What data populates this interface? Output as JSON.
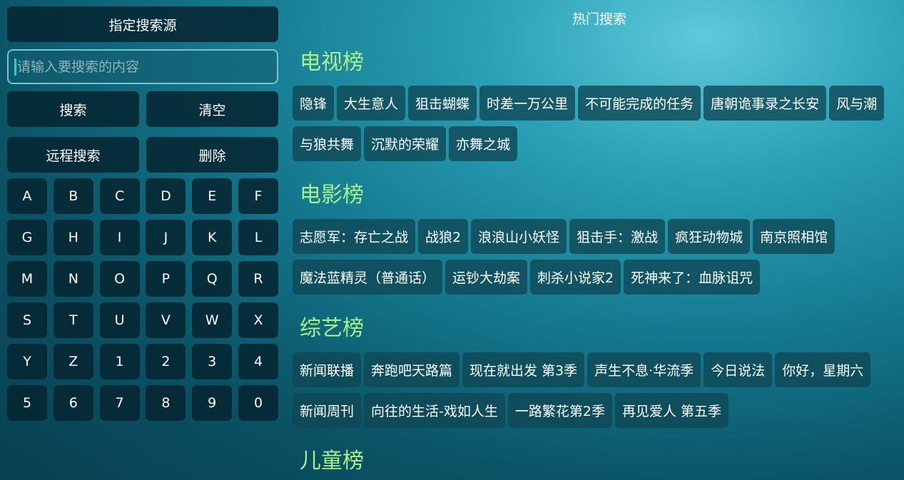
{
  "left": {
    "source_label": "指定搜索源",
    "search_placeholder": "请输入要搜索的内容",
    "search_label": "搜索",
    "clear_label": "清空",
    "remote_label": "远程搜索",
    "delete_label": "删除",
    "keys": [
      "A",
      "B",
      "C",
      "D",
      "E",
      "F",
      "G",
      "H",
      "I",
      "J",
      "K",
      "L",
      "M",
      "N",
      "O",
      "P",
      "Q",
      "R",
      "S",
      "T",
      "U",
      "V",
      "W",
      "X",
      "Y",
      "Z",
      "1",
      "2",
      "3",
      "4",
      "5",
      "6",
      "7",
      "8",
      "9",
      "0"
    ]
  },
  "right": {
    "title": "热门搜索",
    "sections": [
      {
        "name": "电视榜",
        "items": [
          "隐锋",
          "大生意人",
          "狙击蝴蝶",
          "时差一万公里",
          "不可能完成的任务",
          "唐朝诡事录之长安",
          "风与潮",
          "与狼共舞",
          "沉默的荣耀",
          "亦舞之城"
        ]
      },
      {
        "name": "电影榜",
        "items": [
          "志愿军：存亡之战",
          "战狼2",
          "浪浪山小妖怪",
          "狙击手：激战",
          "疯狂动物城",
          "南京照相馆",
          "魔法蓝精灵（普通话）",
          "运钞大劫案",
          "刺杀小说家2",
          "死神来了：血脉诅咒"
        ]
      },
      {
        "name": "综艺榜",
        "items": [
          "新闻联播",
          "奔跑吧天路篇",
          "现在就出发 第3季",
          "声生不息·华流季",
          "今日说法",
          "你好，星期六",
          "新闻周刊",
          "向往的生活-戏如人生",
          "一路繁花第2季",
          "再见爱人 第五季"
        ]
      },
      {
        "name": "儿童榜",
        "items": []
      }
    ]
  }
}
